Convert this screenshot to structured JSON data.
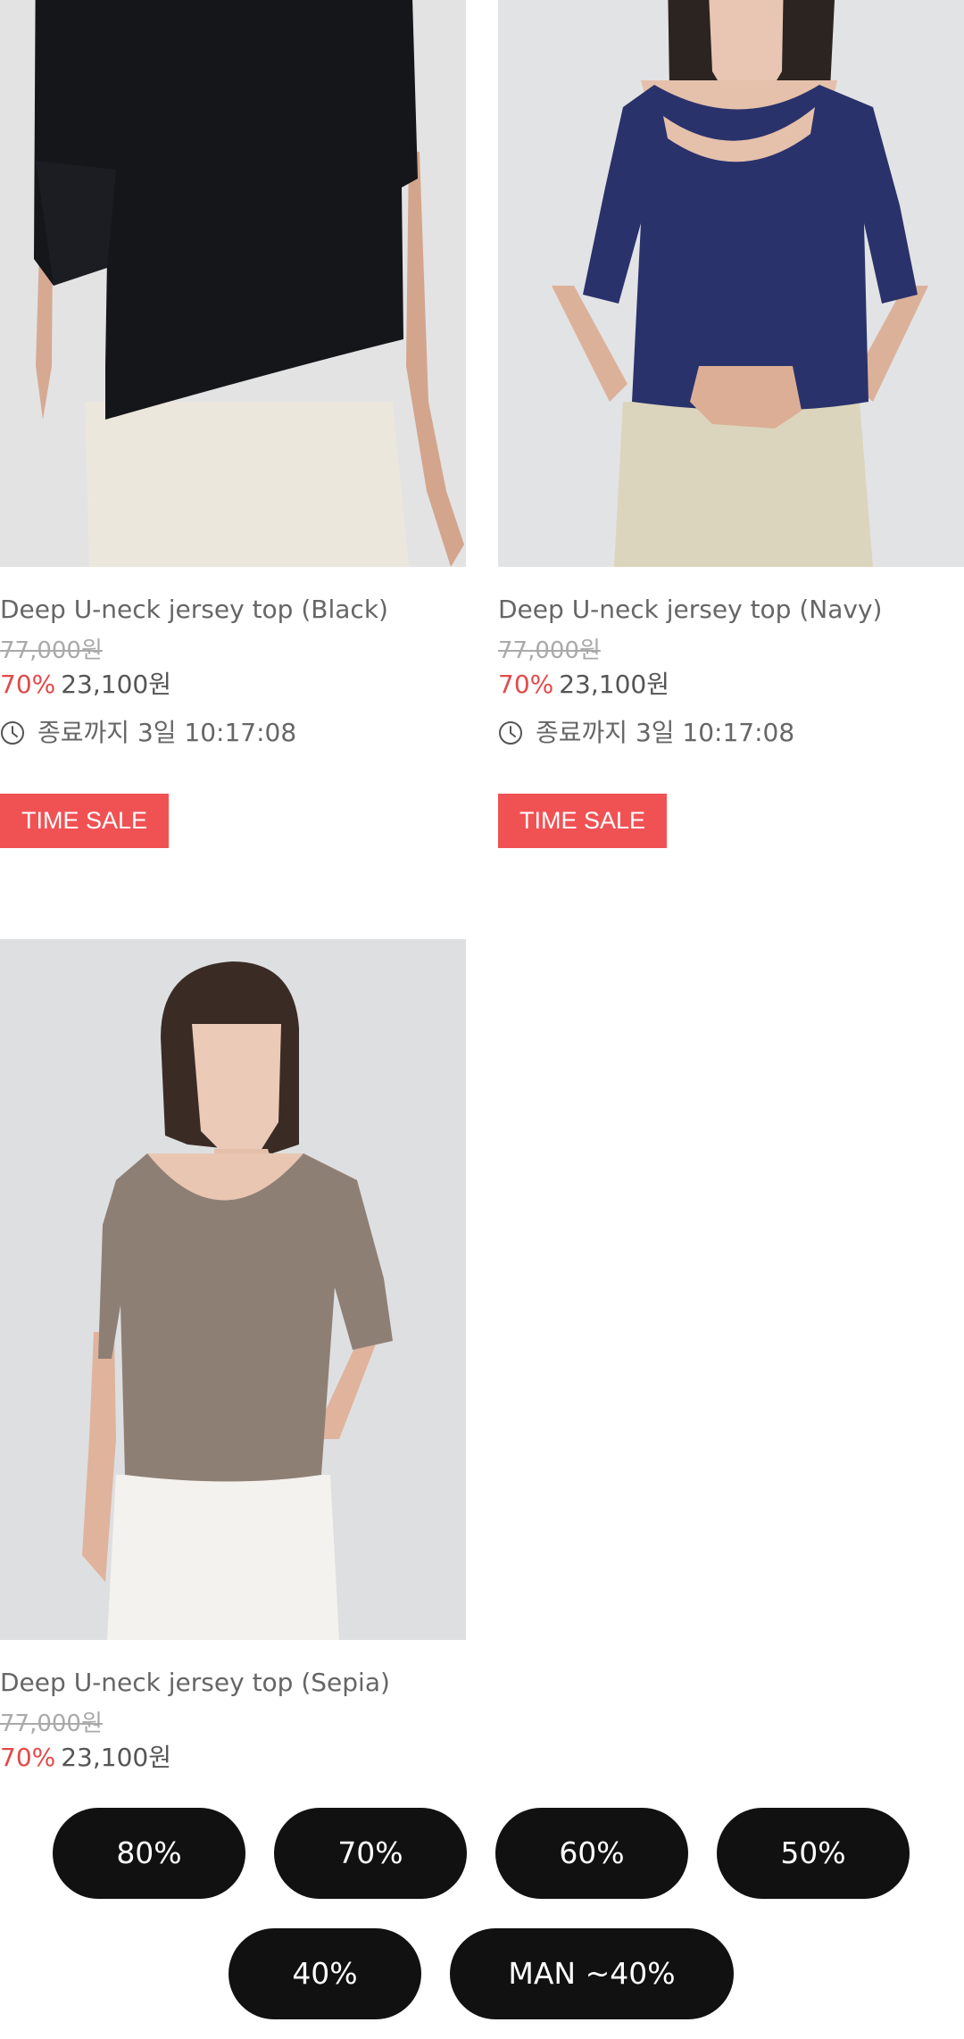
{
  "products": [
    {
      "title": "Deep U-neck jersey top (Black)",
      "original_price": "77,000원",
      "discount": "70%",
      "sale_price": "23,100원",
      "timer": "종료까지 3일 10:17:08",
      "badge": "TIME SALE",
      "top_color": "#15161a",
      "bottom_color": "#ece7dc"
    },
    {
      "title": "Deep U-neck jersey top (Navy)",
      "original_price": "77,000원",
      "discount": "70%",
      "sale_price": "23,100원",
      "timer": "종료까지 3일 10:17:08",
      "badge": "TIME SALE",
      "top_color": "#2a326b",
      "bottom_color": "#dcd5bd"
    },
    {
      "title": "Deep U-neck jersey top (Sepia)",
      "original_price": "77,000원",
      "discount": "70%",
      "sale_price": "23,100원",
      "top_color": "#8e7f75",
      "bottom_color": "#f4f2ee"
    }
  ],
  "filters": [
    {
      "label": "80%"
    },
    {
      "label": "70%"
    },
    {
      "label": "60%"
    },
    {
      "label": "50%"
    },
    {
      "label": "40%"
    },
    {
      "label": "MAN ~40%"
    }
  ],
  "colors": {
    "accent_red": "#f05254",
    "discount_red": "#e24a4a",
    "pill_bg": "#111111"
  }
}
